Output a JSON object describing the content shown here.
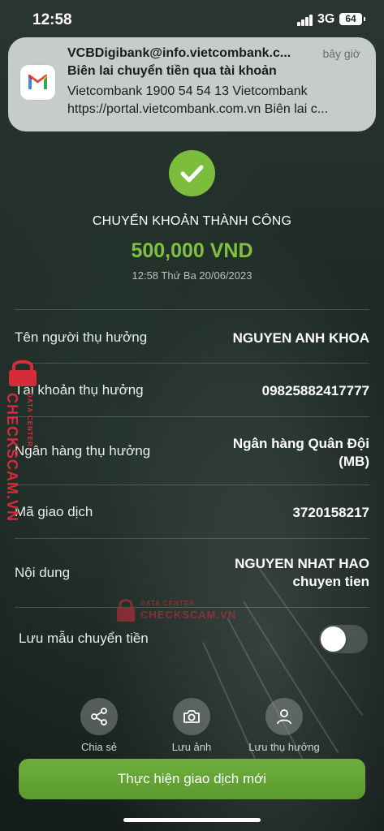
{
  "status_bar": {
    "time": "12:58",
    "network": "3G",
    "battery": "64"
  },
  "notification": {
    "sender": "VCBDigibank@info.vietcombank.c...",
    "time": "bây giờ",
    "subject": "Biên lai chuyển tiền qua tài khoản",
    "line1": "Vietcombank 1900 54 54 13 Vietcombank",
    "line2": "https://portal.vietcombank.com.vn Biên lai c..."
  },
  "result": {
    "title": "CHUYỂN KHOẢN THÀNH CÔNG",
    "amount": "500,000 VND",
    "datetime": "12:58 Thứ Ba 20/06/2023"
  },
  "details": [
    {
      "label": "Tên người thụ hưởng",
      "value": "NGUYEN ANH KHOA"
    },
    {
      "label": "Tài khoản thụ hưởng",
      "value": "09825882417777"
    },
    {
      "label": "Ngân hàng thụ hưởng",
      "value_line1": "Ngân hàng Quân Đội",
      "value_line2": "(MB)"
    },
    {
      "label": "Mã giao dịch",
      "value": "3720158217"
    },
    {
      "label": "Nội dung",
      "value_line1": "NGUYEN NHAT HAO",
      "value_line2": "chuyen tien"
    }
  ],
  "save_template": {
    "label": "Lưu mẫu chuyển tiền",
    "enabled": false
  },
  "actions": [
    {
      "label": "Chia sẻ",
      "icon": "share-icon"
    },
    {
      "label": "Lưu ảnh",
      "icon": "camera-icon"
    },
    {
      "label": "Lưu thụ hưởng",
      "icon": "person-icon"
    }
  ],
  "cta_label": "Thực hiện giao dịch mới",
  "watermark": {
    "brand": "CHECKSCAM.VN",
    "tag": "DATA CENTER"
  },
  "colors": {
    "accent_green": "#7fc241",
    "button_green": "#5f9f33",
    "watermark_red": "#d62c3a"
  }
}
